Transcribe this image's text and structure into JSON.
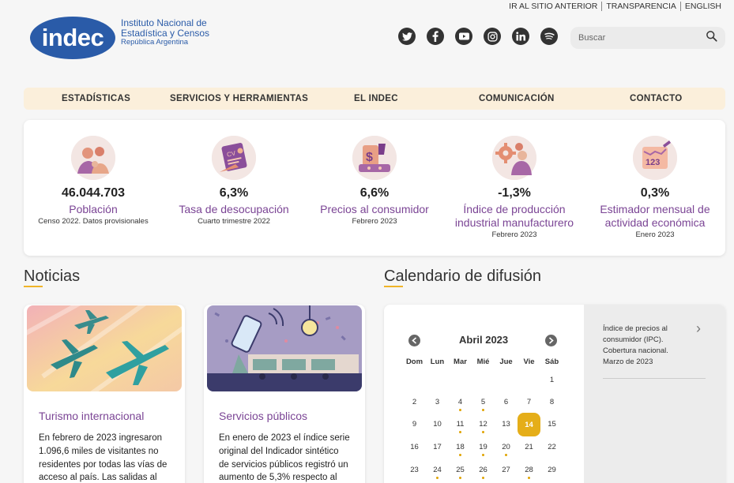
{
  "toplinks": [
    "IR AL SITIO ANTERIOR",
    "TRANSPARENCIA",
    "ENGLISH"
  ],
  "logo": {
    "mark": "indec",
    "line1": "Instituto Nacional de",
    "line2": "Estadística y Censos",
    "line3": "República Argentina"
  },
  "social": [
    "twitter-icon",
    "facebook-icon",
    "youtube-icon",
    "instagram-icon",
    "linkedin-icon",
    "spotify-icon"
  ],
  "search": {
    "placeholder": "Buscar"
  },
  "nav": [
    "ESTADÍSTICAS",
    "SERVICIOS Y HERRAMIENTAS",
    "EL INDEC",
    "COMUNICACIÓN",
    "CONTACTO"
  ],
  "stats": [
    {
      "value": "46.044.703",
      "label": "Población",
      "sub": "Censo 2022. Datos provisionales",
      "icon": "population-icon"
    },
    {
      "value": "6,3%",
      "label": "Tasa de desocupación",
      "sub": "Cuarto trimestre 2022",
      "icon": "cv-icon"
    },
    {
      "value": "6,6%",
      "label": "Precios al consumidor",
      "sub": "Febrero 2023",
      "icon": "price-tag-icon"
    },
    {
      "value": "-1,3%",
      "label": "Índice de producción industrial manufacturero",
      "sub": "Febrero 2023",
      "icon": "gear-icon"
    },
    {
      "value": "0,3%",
      "label": "Estimador mensual de actividad económica",
      "sub": "Enero 2023",
      "icon": "chart-icon"
    }
  ],
  "news": {
    "title": "Noticias",
    "items": [
      {
        "title": "Turismo internacional",
        "text": "En febrero de 2023 ingresaron 1.096,6 miles de visitantes no residentes por todas las vías de acceso al país. Las salidas al"
      },
      {
        "title": "Servicios públicos",
        "text": "En enero de 2023 el índice serie original del Indicador sintético de servicios públicos registró un aumento de 5,3% respecto al"
      }
    ]
  },
  "calendar": {
    "title": "Calendario de difusión",
    "month": "Abril 2023",
    "weekdays": [
      "Dom",
      "Lun",
      "Mar",
      "Mié",
      "Jue",
      "Vie",
      "Sáb"
    ],
    "weeks": [
      [
        "",
        "",
        "",
        "",
        "",
        "",
        "1"
      ],
      [
        "2",
        "3",
        "4",
        "5",
        "6",
        "7",
        "8"
      ],
      [
        "9",
        "10",
        "11",
        "12",
        "13",
        "14",
        "15"
      ],
      [
        "16",
        "17",
        "18",
        "19",
        "20",
        "21",
        "22"
      ],
      [
        "23",
        "24",
        "25",
        "26",
        "27",
        "28",
        "29"
      ]
    ],
    "event_days": [
      "4",
      "5",
      "11",
      "12",
      "18",
      "19",
      "20",
      "24",
      "25",
      "26",
      "28"
    ],
    "selected_day": "14",
    "event": {
      "line1": "Índice de precios al consumidor (IPC).",
      "line2": "Cobertura nacional.",
      "line3": "Marzo de 2023"
    }
  },
  "colors": {
    "brand_blue": "#2a5ba8",
    "purple": "#7b4595",
    "accent": "#f0b429",
    "nav_bg": "#fbefdb"
  }
}
